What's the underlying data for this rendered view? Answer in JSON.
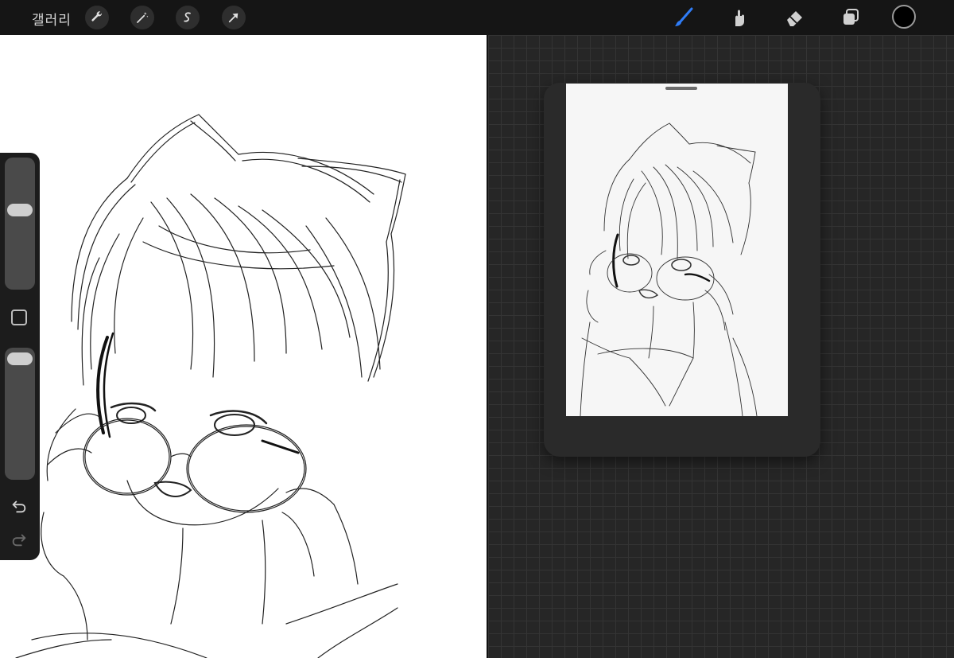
{
  "toolbar": {
    "gallery_label": "갤러리",
    "left_tools": [
      "wrench-icon",
      "magic-wand-icon",
      "selection-icon",
      "transform-arrow-icon"
    ],
    "right_tools": [
      "brush-icon",
      "smudge-icon",
      "eraser-icon",
      "layers-icon"
    ],
    "active_tool": "brush-icon",
    "accent_color": "#2f7cf6",
    "current_color": "#000000"
  },
  "sidebar": {
    "size_slider_level": 0.2,
    "opacity_slider_level": 0.05,
    "modify_button": "square-icon",
    "undo": "undo-icon",
    "redo": "redo-icon"
  },
  "reference_window": {
    "content": "sketch-reference-image"
  }
}
